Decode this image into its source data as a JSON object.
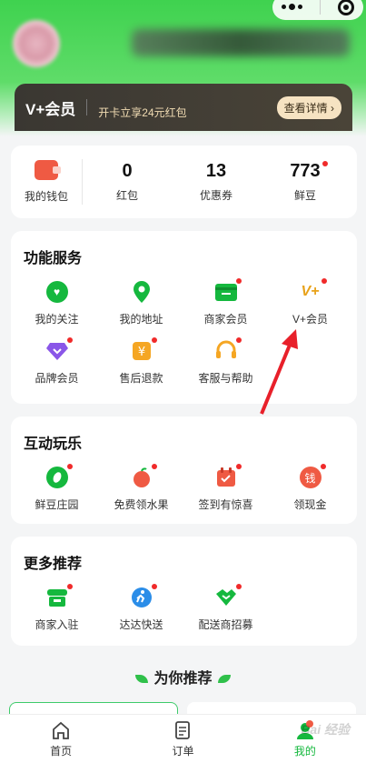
{
  "vip": {
    "logo": "V+会员",
    "promo": "开卡立享24元红包",
    "details_button": "查看详情"
  },
  "wallet": {
    "my_wallet": "我的钱包",
    "items": [
      {
        "value": "0",
        "label": "红包"
      },
      {
        "value": "13",
        "label": "优惠券"
      },
      {
        "value": "773",
        "label": "鲜豆"
      }
    ]
  },
  "services": {
    "title": "功能服务",
    "items": [
      {
        "label": "我的关注",
        "icon": "heart-icon"
      },
      {
        "label": "我的地址",
        "icon": "location-icon"
      },
      {
        "label": "商家会员",
        "icon": "card-icon"
      },
      {
        "label": "V+会员",
        "icon": "vplus-icon"
      },
      {
        "label": "品牌会员",
        "icon": "diamond-icon"
      },
      {
        "label": "售后退款",
        "icon": "yen-icon"
      },
      {
        "label": "客服与帮助",
        "icon": "headset-icon"
      }
    ]
  },
  "fun": {
    "title": "互动玩乐",
    "items": [
      {
        "label": "鲜豆庄园",
        "icon": "bean-icon"
      },
      {
        "label": "免费领水果",
        "icon": "apple-icon"
      },
      {
        "label": "签到有惊喜",
        "icon": "calendar-check-icon"
      },
      {
        "label": "领现金",
        "icon": "cash-icon",
        "glyph": "钱"
      }
    ]
  },
  "more": {
    "title": "更多推荐",
    "items": [
      {
        "label": "商家入驻",
        "icon": "store-icon"
      },
      {
        "label": "达达快送",
        "icon": "courier-icon"
      },
      {
        "label": "配送商招募",
        "icon": "handshake-icon"
      }
    ]
  },
  "recommend": {
    "title": "为你推荐"
  },
  "nav": [
    {
      "label": "首页",
      "icon": "home-icon"
    },
    {
      "label": "订单",
      "icon": "order-icon"
    },
    {
      "label": "我的",
      "icon": "profile-icon"
    }
  ],
  "watermark": "Bai 经验",
  "colors": {
    "brand_green": "#15b83e",
    "alert_red": "#f02a2a",
    "vip_gold": "#f6e3c2"
  }
}
